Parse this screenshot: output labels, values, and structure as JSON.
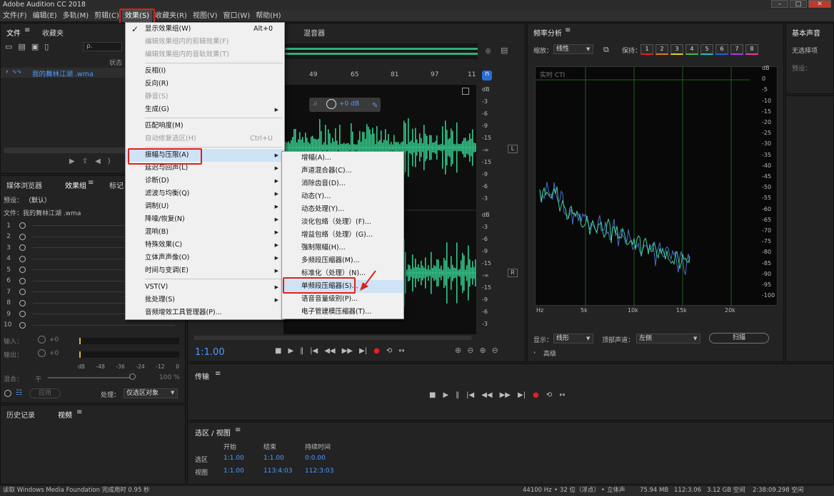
{
  "app": {
    "title": "Adobe Audition CC 2018"
  },
  "menubar": {
    "items": [
      "文件(F)",
      "编辑(E)",
      "多轨(M)",
      "剪辑(C)",
      "效果(S)",
      "收藏夹(R)",
      "视图(V)",
      "窗口(W)",
      "帮助(H)"
    ]
  },
  "effects_menu": {
    "items": [
      {
        "label": "显示效果组(W)",
        "shortcut": "Alt+0",
        "checked": true
      },
      {
        "label": "编辑效果组内的剪辑效果(F)",
        "disabled": true
      },
      {
        "label": "编辑效果组内的音轨效果(T)",
        "disabled": true
      },
      {
        "sep": true
      },
      {
        "label": "反相(I)"
      },
      {
        "label": "反向(R)"
      },
      {
        "label": "静音(S)",
        "disabled": true
      },
      {
        "label": "生成(G)",
        "submenu": true
      },
      {
        "sep": true
      },
      {
        "label": "匹配响度(M)"
      },
      {
        "label": "自动修复选区(H)",
        "shortcut": "Ctrl+U",
        "disabled": true
      },
      {
        "sep": true
      },
      {
        "label": "振幅与压限(A)",
        "submenu": true,
        "highlighted": true
      },
      {
        "label": "延迟与回声(L)",
        "submenu": true
      },
      {
        "label": "诊断(D)",
        "submenu": true
      },
      {
        "label": "滤波与均衡(Q)",
        "submenu": true
      },
      {
        "label": "调制(U)",
        "submenu": true
      },
      {
        "label": "降噪/恢复(N)",
        "submenu": true
      },
      {
        "label": "混响(B)",
        "submenu": true
      },
      {
        "label": "特殊效果(C)",
        "submenu": true
      },
      {
        "label": "立体声声像(O)",
        "submenu": true
      },
      {
        "label": "时间与变调(E)",
        "submenu": true
      },
      {
        "sep": true
      },
      {
        "label": "VST(V)",
        "submenu": true
      },
      {
        "label": "批处理(S)",
        "submenu": true
      },
      {
        "label": "音频增效工具管理器(P)..."
      }
    ]
  },
  "amplitude_submenu": {
    "items": [
      "增幅(A)...",
      "声道混合器(C)...",
      "消除齿音(D)...",
      "动态(Y)...",
      "动态处理(Y)...",
      "淡化包络（处理）(F)...",
      "增益包络（处理）(G)...",
      "强制限幅(H)...",
      "多频段压缩器(M)...",
      "标准化（处理）(N)...",
      "单频段压缩器(S)...",
      "语音音量级别(P)...",
      "电子管建模压缩器(T)..."
    ],
    "highlight_index": 10
  },
  "files_panel": {
    "tab_files": "文件",
    "tab_favorites": "收藏夹",
    "col_status": "状态",
    "file_name": "我的舞林江湖 .wma",
    "search_placeholder": "ρ."
  },
  "effects_rack": {
    "tab_media": "媒体浏览器",
    "tab_effects": "效果组",
    "tab_markers": "标记",
    "preset_label": "预设：",
    "preset_value": "（默认）",
    "file_label": "文件：我的舞林江湖 .wma",
    "slots": [
      "1",
      "2",
      "3",
      "4",
      "5",
      "6",
      "7",
      "8",
      "9",
      "10"
    ],
    "input_label": "输入：",
    "output_label": "输出：",
    "db_plus0": "+0",
    "meter_ticks": [
      "dB",
      "-48",
      "-36",
      "-24",
      "-12",
      "0"
    ],
    "mix_label": "混合：",
    "mix_dry": "干",
    "mix_pct": "100 %",
    "apply_label": "应用",
    "process_label": "处理：",
    "process_value": "仅选区对象"
  },
  "history_panel": {
    "tab_history": "历史记录",
    "tab_video": "视频"
  },
  "editor": {
    "tab_mixer": "混音器",
    "ruler": [
      "49",
      "65",
      "81",
      "97",
      "11"
    ],
    "hud_db": "+0 dB",
    "time": "1:1.00",
    "db_scale_top": [
      "dB",
      "-3",
      "-6",
      "-9",
      "-15",
      "-∞",
      "-15",
      "-9",
      "-6",
      "-3"
    ],
    "db_scale_bottom": [
      "dB",
      "-3",
      "-6",
      "-9",
      "-15",
      "-∞",
      "-15",
      "-9",
      "-6",
      "-3"
    ],
    "ch_L": "L",
    "ch_R": "R"
  },
  "freq_panel": {
    "title": "频率分析",
    "scale_label": "缩放：",
    "scale_value": "线性",
    "hold_label": "保持：",
    "hold_buttons": [
      "1",
      "2",
      "3",
      "4",
      "5",
      "6",
      "7",
      "8"
    ],
    "hold_colors": [
      "#e02020",
      "#e07820",
      "#e0d020",
      "#40c040",
      "#20c0c0",
      "#2060e0",
      "#a040e0",
      "#e040a0"
    ],
    "live_label": "实时 CTI",
    "display_label": "显示：",
    "display_value": "线形",
    "channel_label": "顶部声道：",
    "channel_value": "左侧",
    "scan_button": "扫描",
    "advanced_label": "高级",
    "x_ticks": [
      "Hz",
      "5k",
      "10k",
      "15k",
      "20k"
    ],
    "y_ticks": [
      "dB",
      "0",
      "-5",
      "-10",
      "-15",
      "-20",
      "-25",
      "-30",
      "-35",
      "-40",
      "-45",
      "-50",
      "-55",
      "-60",
      "-65",
      "-70",
      "-75",
      "-80",
      "-85",
      "-90",
      "-95",
      "-100"
    ]
  },
  "essential_panel": {
    "title": "基本声音",
    "no_selection": "无选择项",
    "preset_label": "预设："
  },
  "transport_panel": {
    "title": "传输"
  },
  "selection_panel": {
    "title": "选区 / 视图",
    "col_start": "开始",
    "col_end": "结束",
    "col_duration": "持续时间",
    "row_selection": "选区",
    "row_view": "视图",
    "sel_start": "1:1.00",
    "sel_end": "1:1.00",
    "sel_dur": "0:0.00",
    "view_start": "1:1.00",
    "view_end": "113:4:03",
    "view_dur": "112:3:03"
  },
  "statusbar": {
    "left": "读取 Windows Media Foundation 完成用时 0.95 秒",
    "sample_rate": "44100 Hz",
    "bitdepth": "32 位（浮点）",
    "channels": "立体声",
    "size": "75.94 MB",
    "duration": "112:3.06",
    "free": "3.12 GB 空间",
    "time_free": "2:38:09.298 空闲"
  }
}
